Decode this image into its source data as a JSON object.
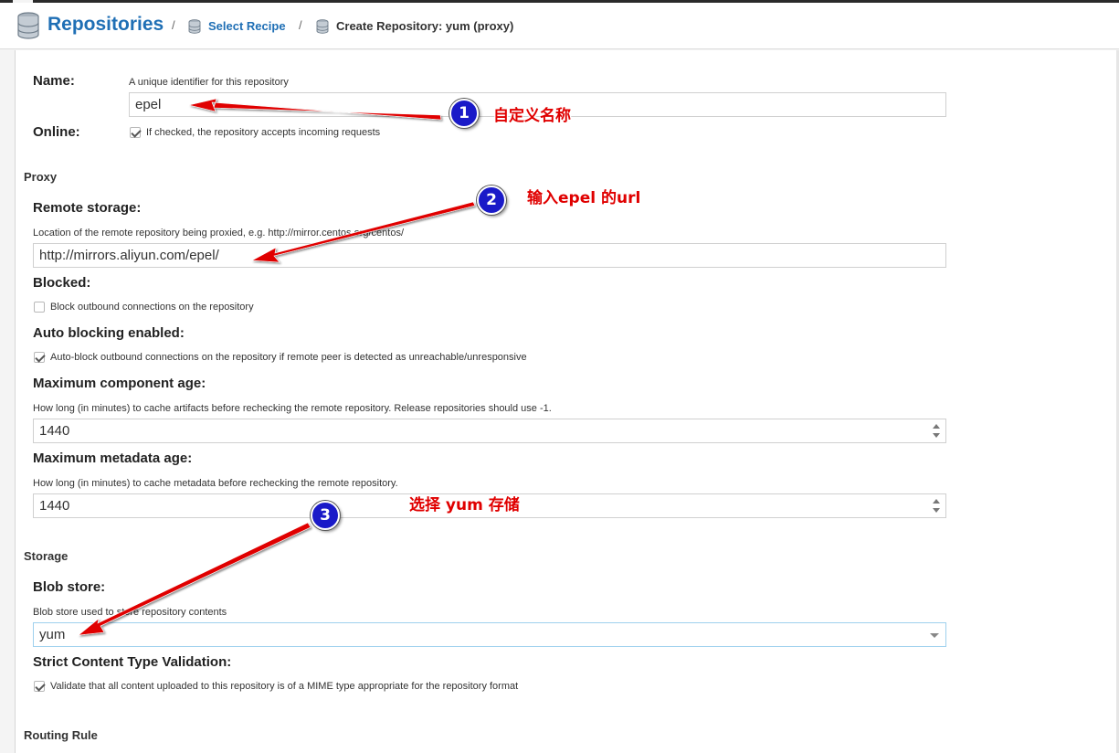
{
  "header": {
    "title": "Repositories",
    "breadcrumb": [
      {
        "label": "Select Recipe"
      },
      {
        "label": "Create Repository: yum (proxy)"
      }
    ],
    "separator": "/"
  },
  "form": {
    "name": {
      "label": "Name:",
      "help": "A unique identifier for this repository",
      "value": "epel"
    },
    "online": {
      "label": "Online:",
      "checked": true,
      "help": "If checked, the repository accepts incoming requests"
    },
    "proxy_section": "Proxy",
    "remote_storage": {
      "label": "Remote storage:",
      "help": "Location of the remote repository being proxied, e.g. http://mirror.centos.org/centos/",
      "value": "http://mirrors.aliyun.com/epel/"
    },
    "blocked": {
      "label": "Blocked:",
      "checked": false,
      "help": "Block outbound connections on the repository"
    },
    "auto_blocking": {
      "label": "Auto blocking enabled:",
      "checked": true,
      "help": "Auto-block outbound connections on the repository if remote peer is detected as unreachable/unresponsive"
    },
    "max_component_age": {
      "label": "Maximum component age:",
      "help": "How long (in minutes) to cache artifacts before rechecking the remote repository. Release repositories should use -1.",
      "value": "1440"
    },
    "max_metadata_age": {
      "label": "Maximum metadata age:",
      "help": "How long (in minutes) to cache metadata before rechecking the remote repository.",
      "value": "1440"
    },
    "storage_section": "Storage",
    "blob_store": {
      "label": "Blob store:",
      "help": "Blob store used to store repository contents",
      "value": "yum"
    },
    "strict_validation": {
      "label": "Strict Content Type Validation:",
      "checked": true,
      "help": "Validate that all content uploaded to this repository is of a MIME type appropriate for the repository format"
    },
    "routing_section": "Routing Rule"
  },
  "annotations": [
    {
      "number": "1",
      "text": "自定义名称"
    },
    {
      "number": "2",
      "text": "输入epel 的url"
    },
    {
      "number": "3",
      "text": "选择 yum 存储"
    }
  ],
  "colors": {
    "link": "#1f6fb5",
    "arrow": "#e00000",
    "badge": "#1a1ac8"
  }
}
